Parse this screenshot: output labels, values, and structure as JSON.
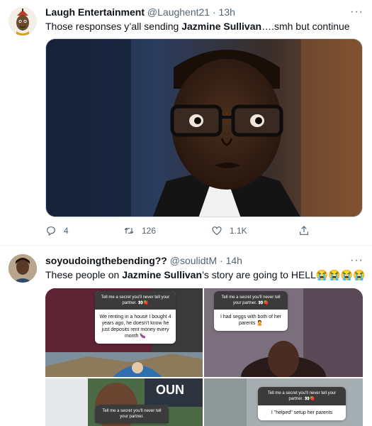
{
  "tweets": [
    {
      "name": "Laugh Entertainment",
      "handle": "@Laughent21",
      "dot": "·",
      "time": "13h",
      "text_before": "Those responses y’all sending ",
      "text_bold": "Jazmine Sullivan",
      "text_after": "….smh but continue",
      "more_label": "···",
      "actions": {
        "replies": "4",
        "retweets": "126",
        "likes": "1.1K"
      }
    },
    {
      "name": "soyoudoingthebending??",
      "handle": "@soulidtM",
      "dot": "·",
      "time": "14h",
      "text_before": "These people on ",
      "text_bold": "Jazmine Sullivan",
      "text_after": "’s story are going to HELL😭😭😭😭",
      "more_label": "···",
      "images": [
        {
          "question": "Tell me a secret you'll never tell your partner. 👀🍓",
          "answer": "We renting in a house I bought 4 years ago, he doesn't know he just deposits rent money every month 🍆"
        },
        {
          "question": "Tell me a secret you'll never tell your partner. 👀🍓",
          "answer": "I had seggs with both of her parents 🙎"
        },
        {
          "question": "Tell me a secret you'll never tell your partner.",
          "answer": ""
        },
        {
          "question": "Tell me a secret you'll never tell your partner. 👀🍓",
          "answer": "I \"helped\" setup her parents"
        }
      ],
      "sign_text": "OUN"
    }
  ],
  "colors": {
    "text": "#0f1419",
    "secondary": "#536471",
    "divider": "#eff3f4"
  }
}
